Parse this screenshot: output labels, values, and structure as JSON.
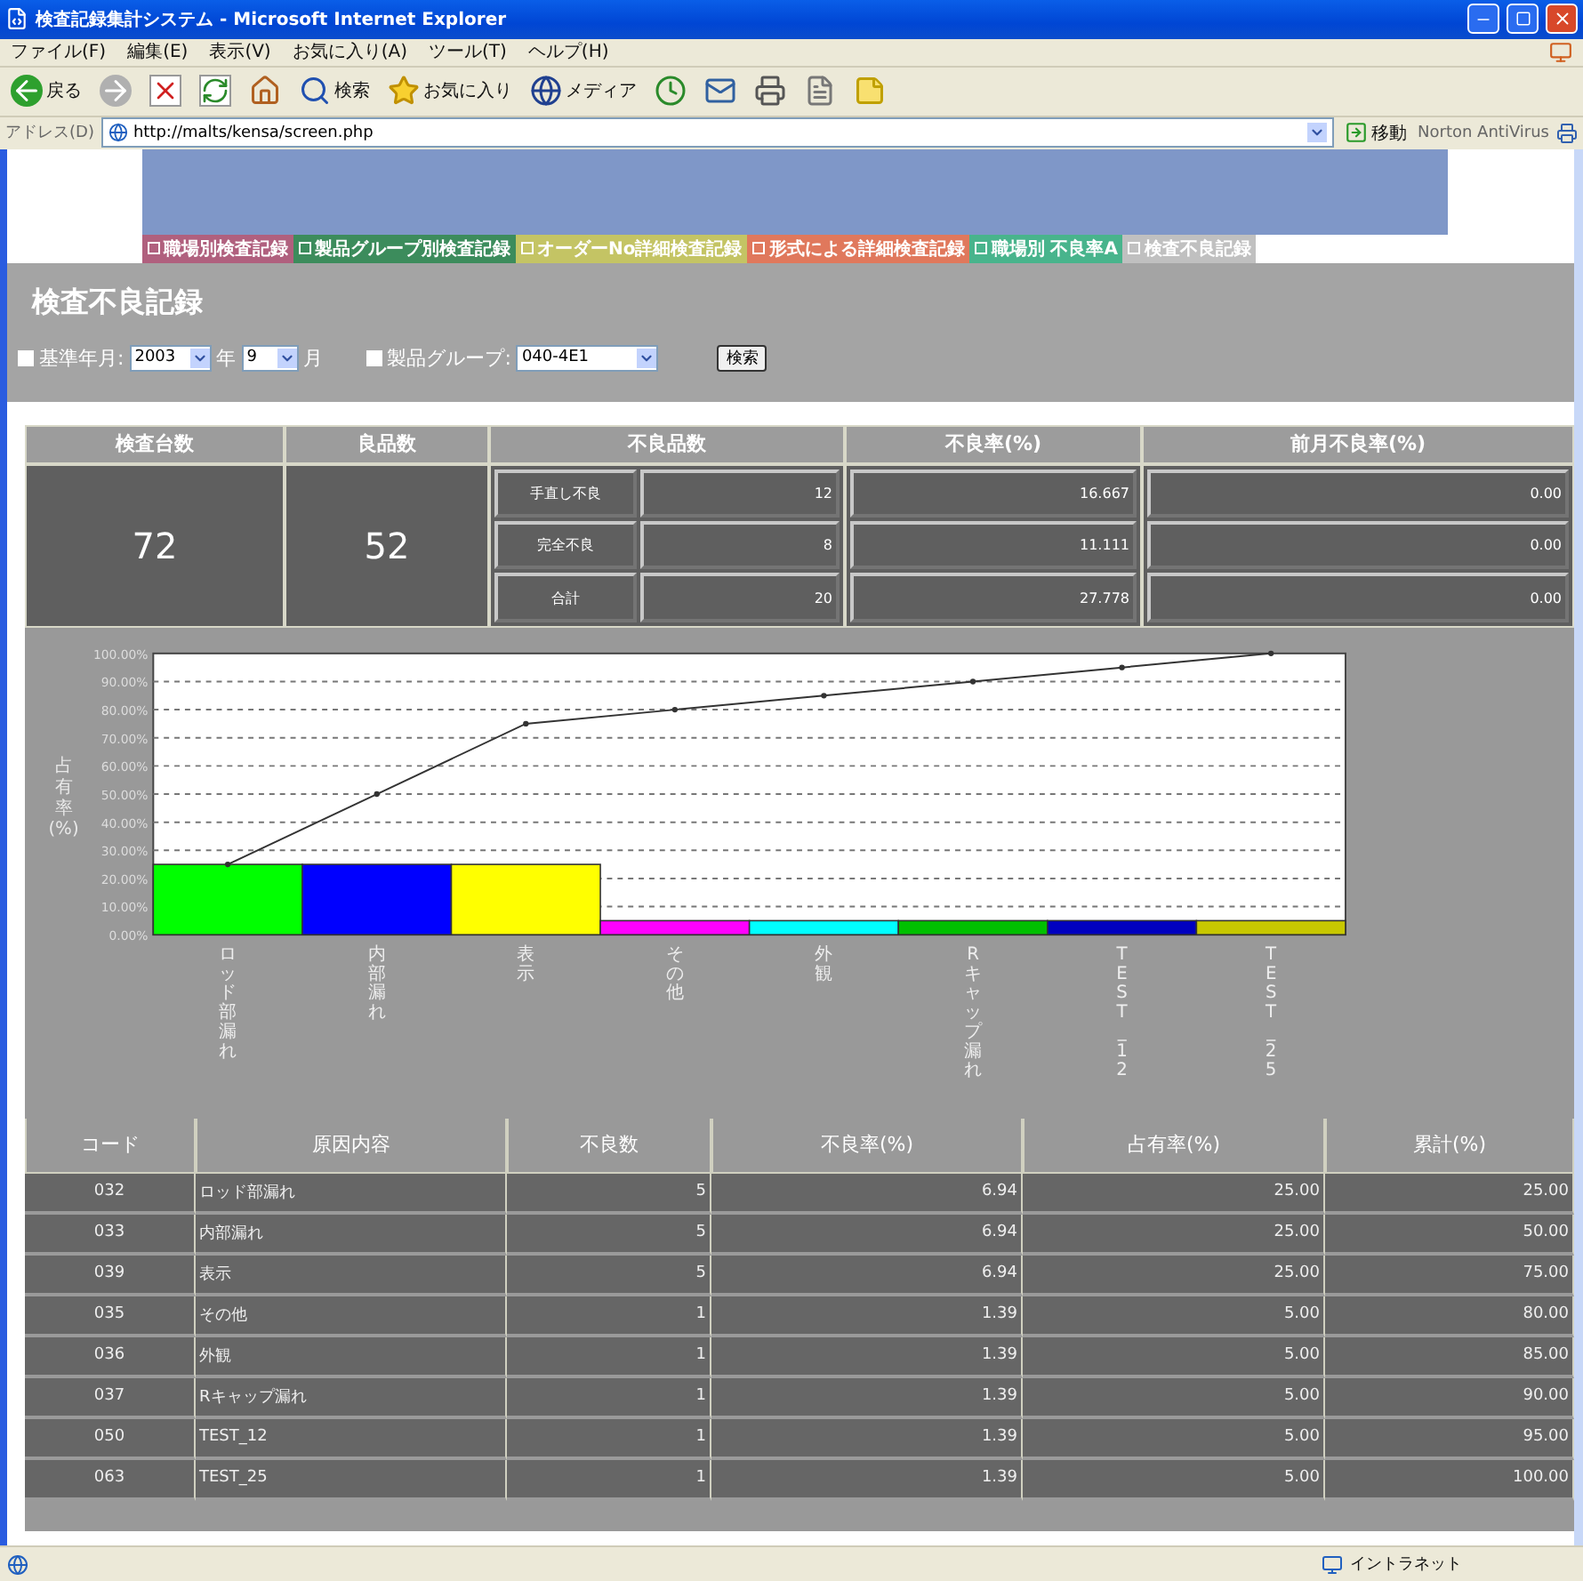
{
  "browser": {
    "title": "検査記録集計システム - Microsoft Internet Explorer",
    "menu": [
      "ファイル(F)",
      "編集(E)",
      "表示(V)",
      "お気に入り(A)",
      "ツール(T)",
      "ヘルプ(H)"
    ],
    "toolbar": [
      {
        "kind": "back",
        "label": "戻る"
      },
      {
        "kind": "forward"
      },
      {
        "kind": "stop"
      },
      {
        "kind": "refresh"
      },
      {
        "kind": "home"
      },
      {
        "kind": "search",
        "label": "検索"
      },
      {
        "kind": "favorites",
        "label": "お気に入り"
      },
      {
        "kind": "media",
        "label": "メディア"
      },
      {
        "kind": "history"
      },
      {
        "kind": "mail"
      },
      {
        "kind": "print"
      },
      {
        "kind": "edit"
      },
      {
        "kind": "note"
      }
    ],
    "address": {
      "label": "アドレス(D)",
      "value": "http://malts/kensa/screen.php",
      "go": "移動",
      "addon": "Norton AntiVirus"
    },
    "status_bar": {
      "zone": "イントラネット"
    }
  },
  "nav": [
    {
      "label": "職場別検査記録",
      "color": "#b0607e"
    },
    {
      "label": "製品グループ別検査記録",
      "color": "#3c8c5c"
    },
    {
      "label": "オーダーNo詳細検査記録",
      "color": "#c4c464"
    },
    {
      "label": "形式による詳細検査記録",
      "color": "#e0785c"
    },
    {
      "label": "職場別 不良率A",
      "color": "#48b48c"
    },
    {
      "label": "検査不良記録",
      "color": "#c0c0c0"
    }
  ],
  "page_title": "検査不良記録",
  "filters": {
    "period_label": "基準年月:",
    "year": "2003",
    "year_unit": "年",
    "month": "9",
    "month_unit": "月",
    "group_label": "製品グループ:",
    "group": "040-4E1",
    "search_button": "検索"
  },
  "summary": {
    "columns": [
      "検査台数",
      "良品数",
      "不良品数",
      "不良率(%)",
      "前月不良率(%)"
    ],
    "inspected": "72",
    "good": "52",
    "rows": [
      {
        "label": "手直し不良",
        "count": "12",
        "rate": "16.667",
        "prev_rate": "0.00"
      },
      {
        "label": "完全不良",
        "count": "8",
        "rate": "11.111",
        "prev_rate": "0.00"
      },
      {
        "label": "合計",
        "count": "20",
        "rate": "27.778",
        "prev_rate": "0.00"
      }
    ]
  },
  "chart": {
    "chart_data": {
      "type": "bar",
      "ylabel": "占有率(%)",
      "categories": [
        "ロッド部漏れ",
        "内部漏れ",
        "表示",
        "その他",
        "外観",
        "Rキャップ漏れ",
        "TEST_12",
        "TEST_25"
      ],
      "series": [
        {
          "colors": [
            "#00ff00",
            "#0000ff",
            "#ffff00",
            "#ff00ff",
            "#00ffff",
            "#00c000",
            "#0000c0",
            "#c8c800"
          ],
          "values": [
            25,
            25,
            25,
            5,
            5,
            5,
            5,
            5
          ]
        },
        {
          "color": "#333333",
          "type": "line",
          "marker": true,
          "values": [
            25,
            50,
            75,
            80,
            85,
            90,
            95,
            100
          ]
        }
      ],
      "ylim": [
        0,
        100
      ],
      "grid": true,
      "yticks": [
        {
          "value": 0,
          "label": "0.00%"
        },
        {
          "value": 10,
          "label": "10.00%"
        },
        {
          "value": 20,
          "label": "20.00%"
        },
        {
          "value": 30,
          "label": "30.00%"
        },
        {
          "value": 40,
          "label": "40.00%"
        },
        {
          "value": 50,
          "label": "50.00%"
        },
        {
          "value": 60,
          "label": "60.00%"
        },
        {
          "value": 70,
          "label": "70.00%"
        },
        {
          "value": 80,
          "label": "80.00%"
        },
        {
          "value": 90,
          "label": "90.00%"
        },
        {
          "value": 100,
          "label": "100.00%"
        }
      ]
    }
  },
  "table": {
    "columns": [
      "コード",
      "原因内容",
      "不良数",
      "不良率(%)",
      "占有率(%)",
      "累計(%)"
    ],
    "rows": [
      [
        "032",
        "ロッド部漏れ",
        "5",
        "6.94",
        "25.00",
        "25.00"
      ],
      [
        "033",
        "内部漏れ",
        "5",
        "6.94",
        "25.00",
        "50.00"
      ],
      [
        "039",
        "表示",
        "5",
        "6.94",
        "25.00",
        "75.00"
      ],
      [
        "035",
        "その他",
        "1",
        "1.39",
        "5.00",
        "80.00"
      ],
      [
        "036",
        "外観",
        "1",
        "1.39",
        "5.00",
        "85.00"
      ],
      [
        "037",
        "Rキャップ漏れ",
        "1",
        "1.39",
        "5.00",
        "90.00"
      ],
      [
        "050",
        "TEST_12",
        "1",
        "1.39",
        "5.00",
        "95.00"
      ],
      [
        "063",
        "TEST_25",
        "1",
        "1.39",
        "5.00",
        "100.00"
      ]
    ]
  }
}
